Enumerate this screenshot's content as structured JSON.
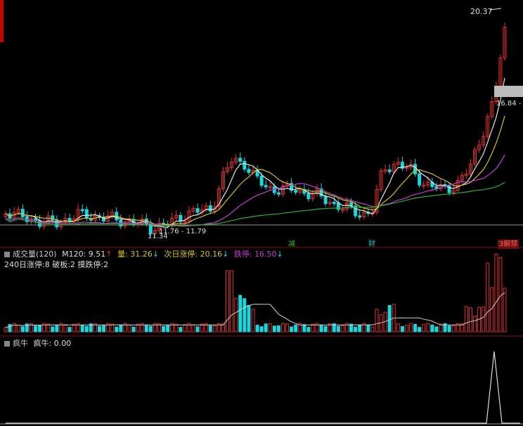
{
  "colors": {
    "up": "#e23030",
    "down": "#19d7dd",
    "ma_white": "#e6e6e6",
    "ma_yellow": "#d8c22a",
    "ma_purple": "#c43fd0",
    "ma_green": "#2fae2f",
    "grid": "#8a1111",
    "divider": "#9a9a9a"
  },
  "price_panel": {
    "high_label": "20.37",
    "right_label": "16.84 -",
    "low_label": "11.34",
    "range_label": "11.76 - 11.79",
    "bottom_marks": [
      {
        "text": "减",
        "color": "#29c429"
      },
      {
        "text": "财",
        "color": "#29c4c4"
      },
      {
        "text": "3解禁",
        "color": "#ff5a5a"
      }
    ]
  },
  "volume_panel": {
    "title": "成交量(120)",
    "m120_label": "M120: 9.51",
    "m120_arrow": "↑",
    "vol_label": "量: 31.26",
    "vol_arrow": "↓",
    "next_limit_up": "次日涨停: 20.16",
    "next_limit_up_arrow": "↓",
    "limit_down": "跌停: 16.50",
    "limit_down_arrow": "↓",
    "stats": "240日涨停:8 破板:2 摸跌停:2"
  },
  "indicator_panel": {
    "title": "疯牛",
    "value_label": "疯牛: 0.00"
  }
}
